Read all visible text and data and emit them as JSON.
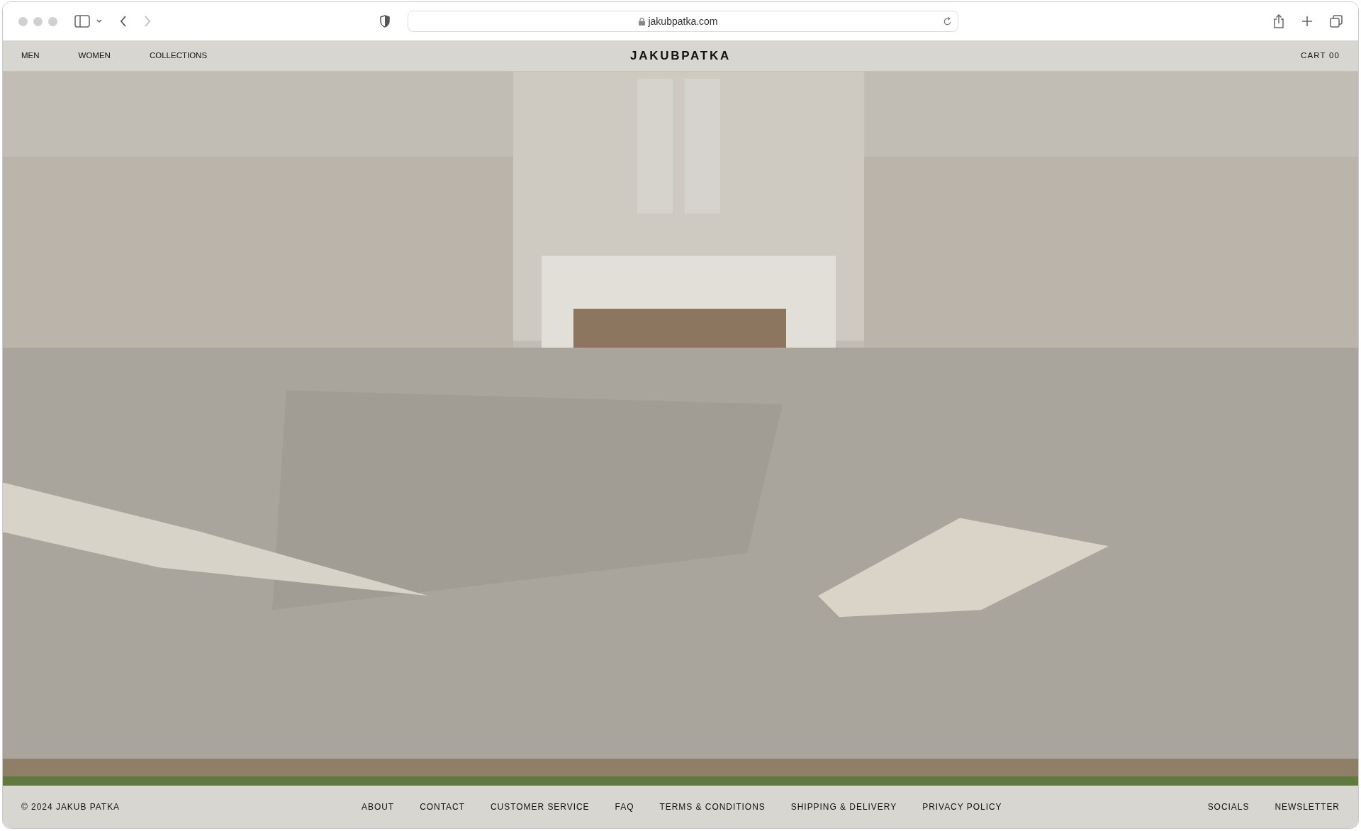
{
  "browser": {
    "url": "jakubpatka.com"
  },
  "nav": {
    "left": [
      "MEN",
      "WOMEN",
      "COLLECTIONS"
    ],
    "logo": "JAKUBPATKA",
    "cart": "CART 00"
  },
  "footer": {
    "copyright": "© 2024 JAKUB PATKA",
    "links": [
      "ABOUT",
      "CONTACT",
      "CUSTOMER SERVICE",
      "FAQ",
      "TERMS & CONDITIONS",
      "SHIPPING & DELIVERY",
      "PRIVACY POLICY"
    ],
    "right": [
      "SOCIALS",
      "NEWSLETTER"
    ]
  }
}
